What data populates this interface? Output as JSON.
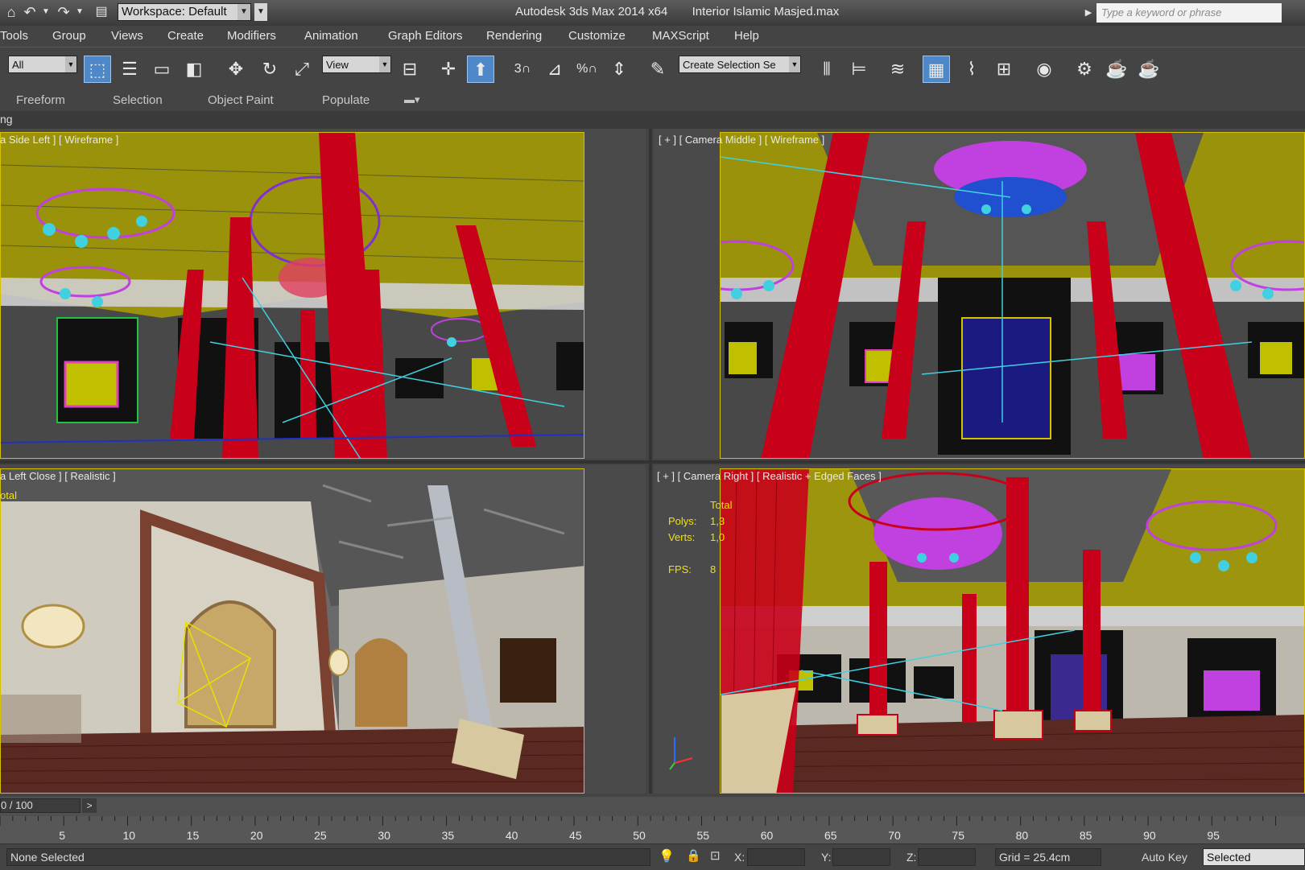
{
  "titlebar": {
    "workspace_label": "Workspace: Default",
    "app_title": "Autodesk 3ds Max  2014 x64",
    "file_name": "Interior Islamic Masjed.max",
    "search_placeholder": "Type a keyword or phrase"
  },
  "menu": [
    "Tools",
    "Group",
    "Views",
    "Create",
    "Modifiers",
    "Animation",
    "Graph Editors",
    "Rendering",
    "Customize",
    "MAXScript",
    "Help"
  ],
  "toolbar": {
    "filter_select": "All",
    "refcoord_select": "View",
    "selection_set": "Create Selection Se",
    "snap_angle_digit": "3",
    "snap_percent": "%",
    "icons": [
      "select-object-icon",
      "select-by-name-icon",
      "rectangular-selection-icon",
      "window-crossing-icon",
      "select-and-move-icon",
      "select-and-rotate-icon",
      "select-and-scale-icon",
      "pivot-center-icon",
      "manipulate-icon",
      "snaps-toggle-icon",
      "angle-snap-icon",
      "percent-snap-icon",
      "spinner-snap-icon",
      "edit-named-selection-icon",
      "mirror-icon",
      "align-icon",
      "layer-manager-icon",
      "scene-explorer-icon",
      "curve-editor-icon",
      "schematic-view-icon",
      "material-editor-icon",
      "render-setup-icon",
      "rendered-frame-window-icon",
      "render-production-icon"
    ]
  },
  "ribbon": {
    "tabs": [
      "Freeform",
      "Selection",
      "Object Paint",
      "Populate"
    ],
    "sub_label": "ng"
  },
  "viewports": {
    "top_left": {
      "label": "a Side Left ] [ Wireframe ]"
    },
    "top_right": {
      "label": "[ + ] [ Camera Middle ] [ Wireframe ]"
    },
    "bottom_left": {
      "label": "a Left Close ] [ Realistic ]",
      "stat_total": "otal"
    },
    "bottom_right": {
      "label": "[ + ] [ Camera Right ] [ Realistic + Edged Faces ]",
      "stats": {
        "total_label": "Total",
        "polys_label": "Polys:",
        "polys_value": "1,3",
        "verts_label": "Verts:",
        "verts_value": "1,0",
        "fps_label": "FPS:",
        "fps_value": "8"
      }
    }
  },
  "timeline": {
    "frame_counter": "0 / 100",
    "next_arrow": ">",
    "ticks": [
      "5",
      "10",
      "15",
      "20",
      "25",
      "30",
      "35",
      "40",
      "45",
      "50",
      "55",
      "60",
      "65",
      "70",
      "75",
      "80",
      "85",
      "90",
      "95"
    ]
  },
  "statusbar": {
    "selection_status": "None Selected",
    "x_label": "X:",
    "y_label": "Y:",
    "z_label": "Z:",
    "grid": "Grid = 25.4cm",
    "auto_key": "Auto Key",
    "selected_dropdown": "Selected"
  },
  "colors": {
    "viewport_border_active": "#d6c000",
    "wire_yellow": "#c8c000",
    "wire_red": "#c8001a",
    "wire_magenta": "#c040e0",
    "wire_cyan": "#40d0e0"
  }
}
